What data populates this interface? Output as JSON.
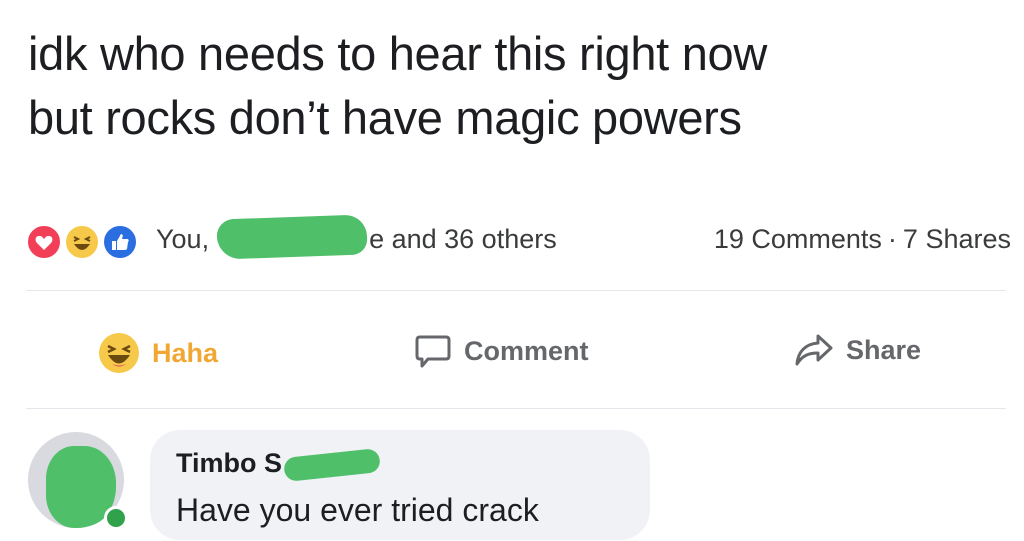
{
  "post": {
    "text_lines": [
      "idk who needs to hear this right now",
      "but rocks don’t have magic powers"
    ]
  },
  "summary": {
    "reactions": [
      "love-icon",
      "haha-icon",
      "like-icon"
    ],
    "reacted_by_prefix": "You,",
    "reacted_by_suffix": "e and 36 others",
    "comments": "19 Comments",
    "separator": "·",
    "shares": "7 Shares"
  },
  "actions": {
    "haha_label": "Haha",
    "comment_label": "Comment",
    "share_label": "Share"
  },
  "comment": {
    "author": "Timbo S",
    "text": "Have you ever tried crack"
  },
  "colors": {
    "redaction": "#4fbf6a",
    "haha_active": "#f0a733",
    "online": "#31a24c"
  }
}
